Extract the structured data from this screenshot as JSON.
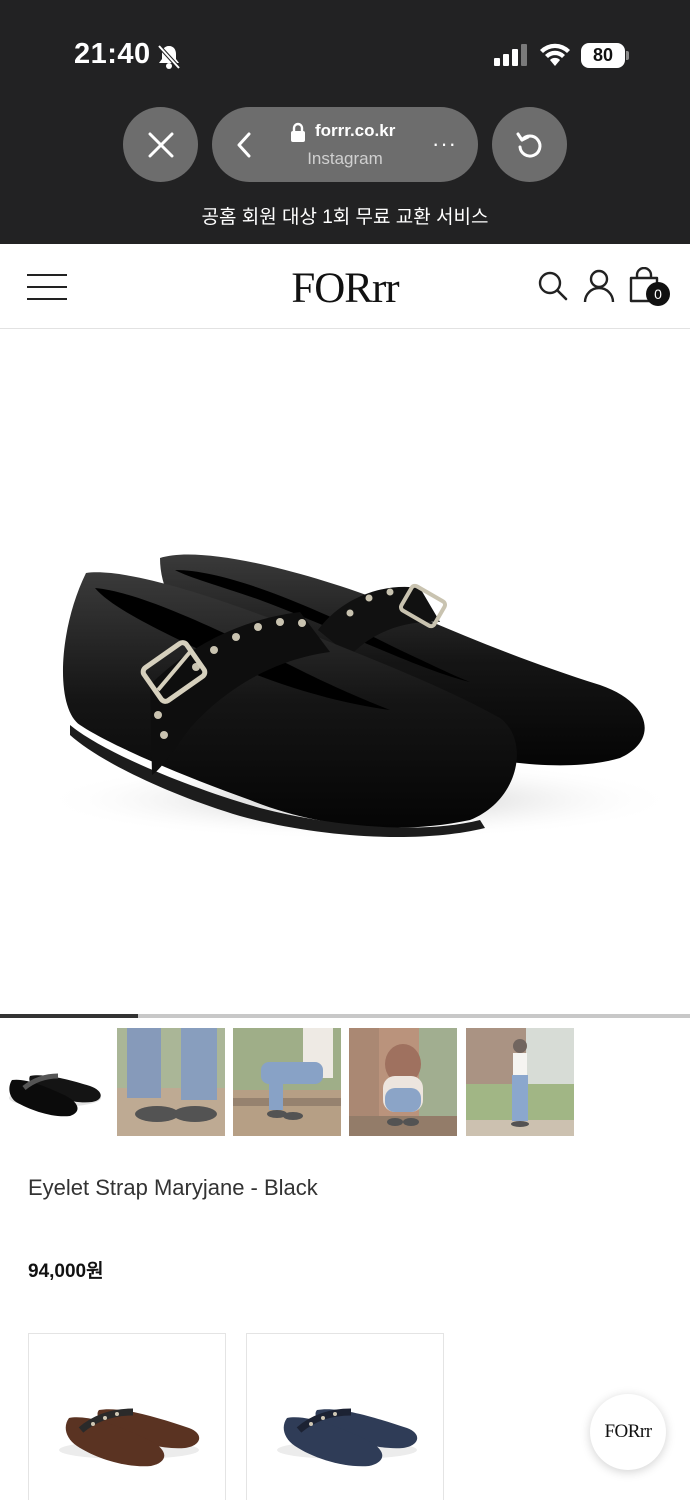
{
  "status_bar": {
    "time": "21:40",
    "battery": "80"
  },
  "browser": {
    "domain": "forrr.co.kr",
    "source": "Instagram",
    "more": "···"
  },
  "promo_banner": "공홈 회원 대상 1회 무료 교환 서비스",
  "header": {
    "logo": "FORrr",
    "cart_count": "0"
  },
  "gallery": {
    "progress": 0.2,
    "thumbnails": [
      {
        "name": "thumb-product-black",
        "scene": "product"
      },
      {
        "name": "thumb-worn-jeans",
        "scene": "lifestyle"
      },
      {
        "name": "thumb-sitting-bench",
        "scene": "lifestyle"
      },
      {
        "name": "thumb-crouching",
        "scene": "lifestyle"
      },
      {
        "name": "thumb-standing-garden",
        "scene": "lifestyle"
      }
    ]
  },
  "product": {
    "name": "Eyelet Strap Maryjane - Black",
    "price": "94,000원"
  },
  "related": [
    {
      "color": "brown",
      "shoe_hex": "#5a3322"
    },
    {
      "color": "navy-denim",
      "shoe_hex": "#2f3c57"
    }
  ],
  "floating_button": "FORrr",
  "colors": {
    "chrome_bg": "#222223",
    "pill_bg": "#6d6d6d",
    "text_dark": "#111111"
  }
}
